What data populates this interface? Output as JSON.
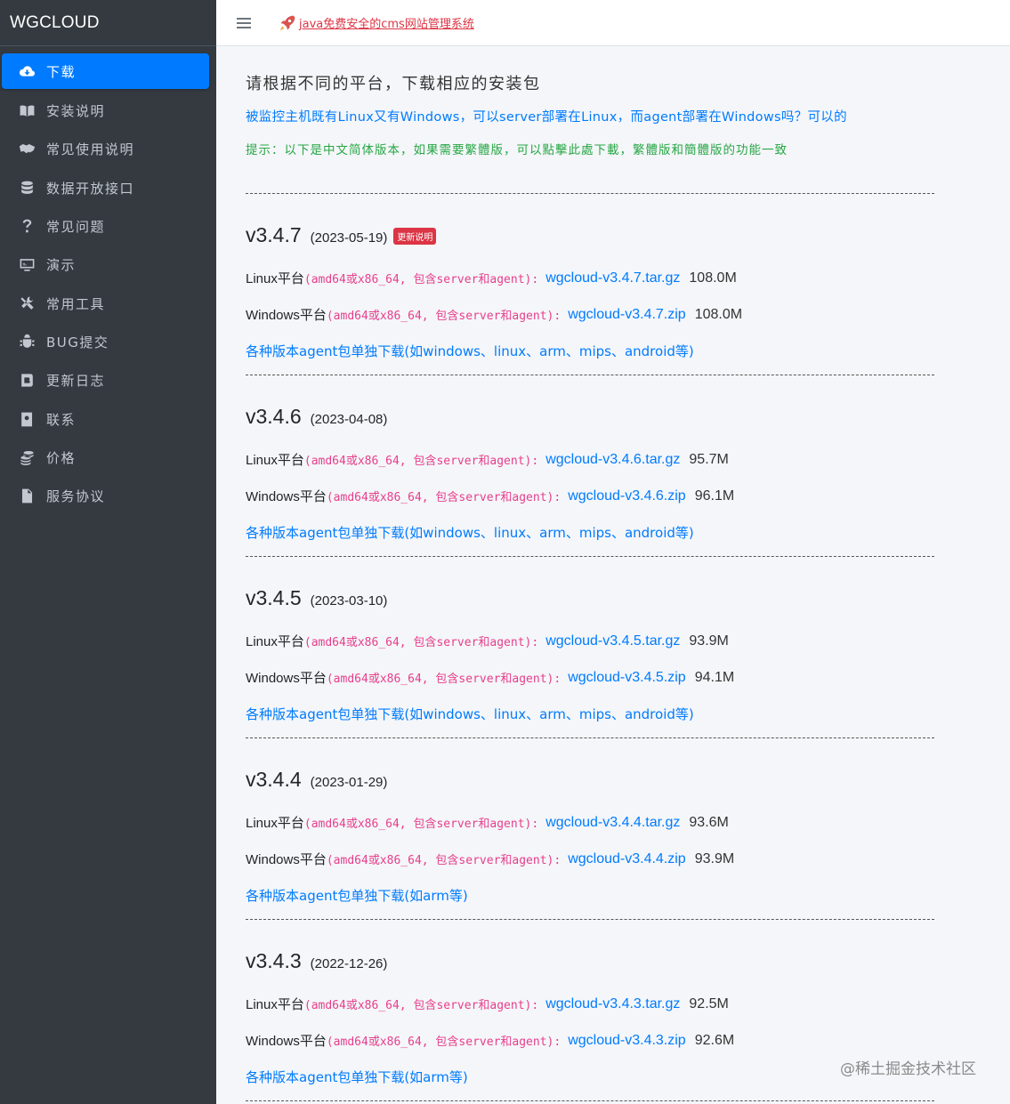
{
  "brand": "WGCLOUD",
  "sidebar": {
    "items": [
      {
        "label": "下载",
        "icon": "cloud-download-icon"
      },
      {
        "label": "安装说明",
        "icon": "book-icon"
      },
      {
        "label": "常见使用说明",
        "icon": "handshake-icon"
      },
      {
        "label": "数据开放接口",
        "icon": "database-icon"
      },
      {
        "label": "常见问题",
        "icon": "question-icon"
      },
      {
        "label": "演示",
        "icon": "monitor-icon"
      },
      {
        "label": "常用工具",
        "icon": "tools-icon"
      },
      {
        "label": "BUG提交",
        "icon": "bug-icon"
      },
      {
        "label": "更新日志",
        "icon": "blog-icon"
      },
      {
        "label": "联系",
        "icon": "contact-icon"
      },
      {
        "label": "价格",
        "icon": "coins-icon"
      },
      {
        "label": "服务协议",
        "icon": "file-icon"
      }
    ]
  },
  "topbar": {
    "menu_icon": "hamburger-icon",
    "link_text": "java免费安全的cms网站管理系统",
    "link_icon": "rocket-icon"
  },
  "content": {
    "lead": "请根据不同的平台，下载相应的安装包",
    "faq": "被监控主机既有Linux又有Windows，可以server部署在Linux，而agent部署在Windows吗？可以的",
    "tip": "提示：以下是中文简体版本，如果需要繁體版，可以點擊此處下載，繁體版和簡體版的功能一致",
    "divider": "--------------------------------------------------------------------------------------------------------------------------------------------------"
  },
  "releases": [
    {
      "version": "v3.4.7",
      "date": "(2023-05-19)",
      "badge": "更新说明",
      "linux_label": "Linux平台",
      "linux_arch": "(amd64或x86_64, 包含server和agent):",
      "linux_file": "wgcloud-v3.4.7.tar.gz",
      "linux_size": "108.0M",
      "win_label": "Windows平台",
      "win_arch": "(amd64或x86_64, 包含server和agent):",
      "win_file": "wgcloud-v3.4.7.zip",
      "win_size": "108.0M",
      "agent_text": "各种版本agent包单独下载(如windows、linux、arm、mips、android等)"
    },
    {
      "version": "v3.4.6",
      "date": "(2023-04-08)",
      "badge": "",
      "linux_label": "Linux平台",
      "linux_arch": "(amd64或x86_64, 包含server和agent):",
      "linux_file": "wgcloud-v3.4.6.tar.gz",
      "linux_size": "95.7M",
      "win_label": "Windows平台",
      "win_arch": "(amd64或x86_64, 包含server和agent):",
      "win_file": "wgcloud-v3.4.6.zip",
      "win_size": "96.1M",
      "agent_text": "各种版本agent包单独下载(如windows、linux、arm、mips、android等)"
    },
    {
      "version": "v3.4.5",
      "date": "(2023-03-10)",
      "badge": "",
      "linux_label": "Linux平台",
      "linux_arch": "(amd64或x86_64, 包含server和agent):",
      "linux_file": "wgcloud-v3.4.5.tar.gz",
      "linux_size": "93.9M",
      "win_label": "Windows平台",
      "win_arch": "(amd64或x86_64, 包含server和agent):",
      "win_file": "wgcloud-v3.4.5.zip",
      "win_size": "94.1M",
      "agent_text": "各种版本agent包单独下载(如windows、linux、arm、mips、android等)"
    },
    {
      "version": "v3.4.4",
      "date": "(2023-01-29)",
      "badge": "",
      "linux_label": "Linux平台",
      "linux_arch": "(amd64或x86_64, 包含server和agent):",
      "linux_file": "wgcloud-v3.4.4.tar.gz",
      "linux_size": "93.6M",
      "win_label": "Windows平台",
      "win_arch": "(amd64或x86_64, 包含server和agent):",
      "win_file": "wgcloud-v3.4.4.zip",
      "win_size": "93.9M",
      "agent_text": "各种版本agent包单独下载(如arm等)"
    },
    {
      "version": "v3.4.3",
      "date": "(2022-12-26)",
      "badge": "",
      "linux_label": "Linux平台",
      "linux_arch": "(amd64或x86_64, 包含server和agent):",
      "linux_file": "wgcloud-v3.4.3.tar.gz",
      "linux_size": "92.5M",
      "win_label": "Windows平台",
      "win_arch": "(amd64或x86_64, 包含server和agent):",
      "win_file": "wgcloud-v3.4.3.zip",
      "win_size": "92.6M",
      "agent_text": "各种版本agent包单独下载(如arm等)"
    }
  ],
  "watermark": "@稀土掘金技术社区",
  "colors": {
    "sidebar_bg": "#343a40",
    "active": "#007bff",
    "link": "#007bff",
    "tip": "#28a745",
    "code": "#e83e8c",
    "badge": "#dc3545"
  }
}
